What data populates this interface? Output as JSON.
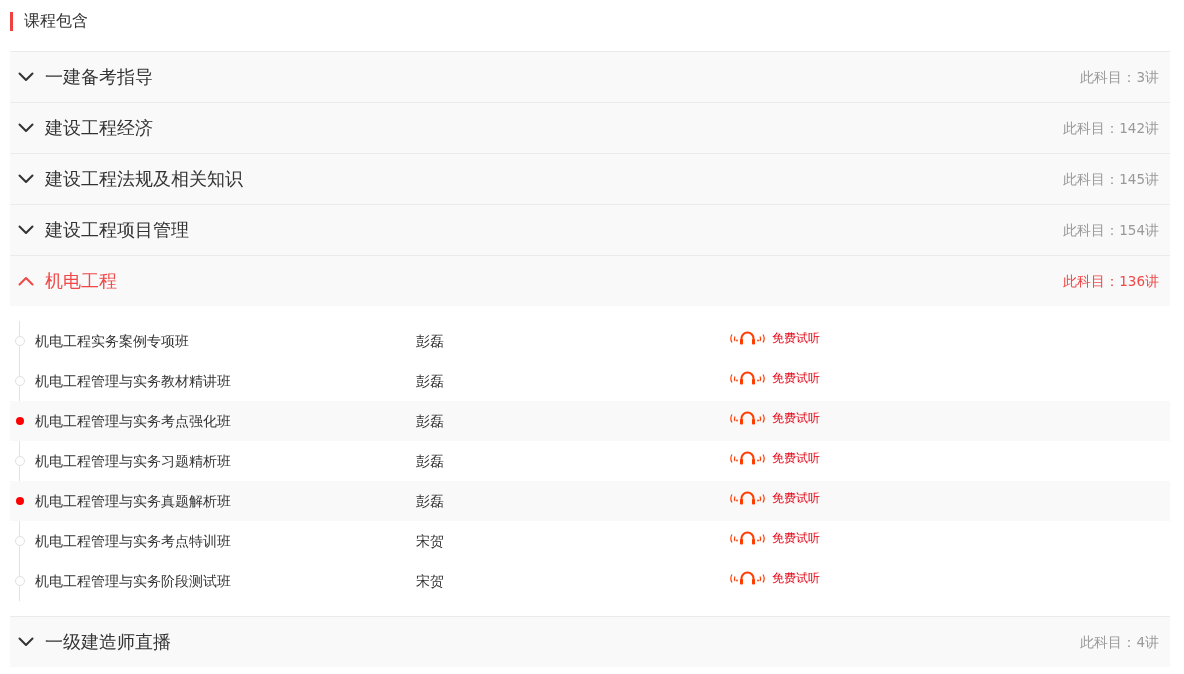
{
  "section_title": "课程包含",
  "subjects": [
    {
      "name": "一建备考指导",
      "count": "此科目：3讲",
      "expanded": false
    },
    {
      "name": "建设工程经济",
      "count": "此科目：142讲",
      "expanded": false
    },
    {
      "name": "建设工程法规及相关知识",
      "count": "此科目：145讲",
      "expanded": false
    },
    {
      "name": "建设工程项目管理",
      "count": "此科目：154讲",
      "expanded": false
    },
    {
      "name": "机电工程",
      "count": "此科目：136讲",
      "expanded": true,
      "lessons": [
        {
          "title": "机电工程实务案例专项班",
          "teacher": "彭磊",
          "trial": "免费试听",
          "selected": false
        },
        {
          "title": "机电工程管理与实务教材精讲班",
          "teacher": "彭磊",
          "trial": "免费试听",
          "selected": false
        },
        {
          "title": "机电工程管理与实务考点强化班",
          "teacher": "彭磊",
          "trial": "免费试听",
          "selected": true
        },
        {
          "title": "机电工程管理与实务习题精析班",
          "teacher": "彭磊",
          "trial": "免费试听",
          "selected": false
        },
        {
          "title": "机电工程管理与实务真题解析班",
          "teacher": "彭磊",
          "trial": "免费试听",
          "selected": true
        },
        {
          "title": "机电工程管理与实务考点特训班",
          "teacher": "宋贺",
          "trial": "免费试听",
          "selected": false
        },
        {
          "title": "机电工程管理与实务阶段测试班",
          "teacher": "宋贺",
          "trial": "免费试听",
          "selected": false
        }
      ]
    },
    {
      "name": "一级建造师直播",
      "count": "此科目：4讲",
      "expanded": false
    }
  ]
}
